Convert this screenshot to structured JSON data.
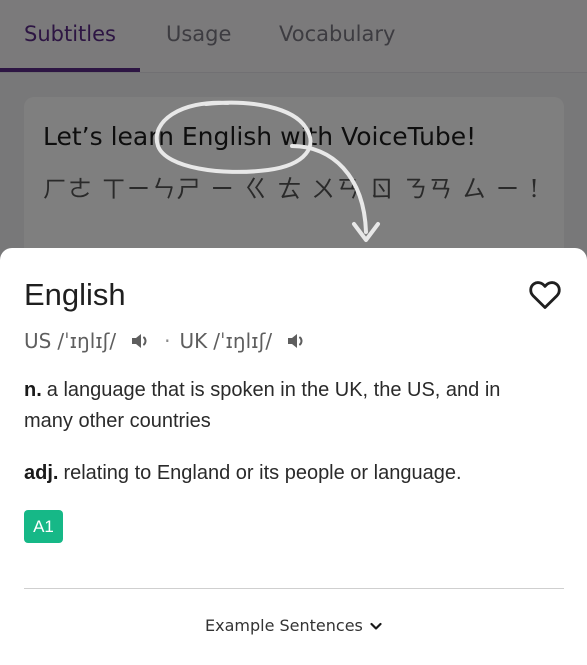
{
  "tabs": [
    {
      "label": "Subtitles",
      "active": true
    },
    {
      "label": "Usage",
      "active": false
    },
    {
      "label": "Vocabulary",
      "active": false
    }
  ],
  "subtitle": {
    "english": "Let’s learn English with VoiceTube!",
    "chinese": "ㄏㄜ ㄒㄧㄣㄕ ㄧ ㄍ ㄊ ㄨㄢ ㄖ ㄋㄢ ㄙ ㄧ !"
  },
  "entry": {
    "word": "English",
    "us_label": "US",
    "us_ipa": "/ˈɪŋlɪʃ/",
    "separator": "·",
    "uk_label": "UK",
    "uk_ipa": "/ˈɪŋlɪʃ/",
    "definitions": [
      {
        "pos": "n.",
        "text": "a language that is spoken in the UK, the US, and in many other countries"
      },
      {
        "pos": "adj.",
        "text": "relating to England or its people or language."
      }
    ],
    "level": "A1",
    "example_sentences_label": "Example Sentences"
  },
  "icons": {
    "favorite": "heart-outline-icon",
    "pronounce": "speaker-icon",
    "expand": "chevron-down-icon"
  },
  "colors": {
    "brand_purple": "#5b2a86",
    "level_badge": "#16b887",
    "text_primary": "#1f1f1f",
    "text_secondary": "#5e5e5e"
  }
}
